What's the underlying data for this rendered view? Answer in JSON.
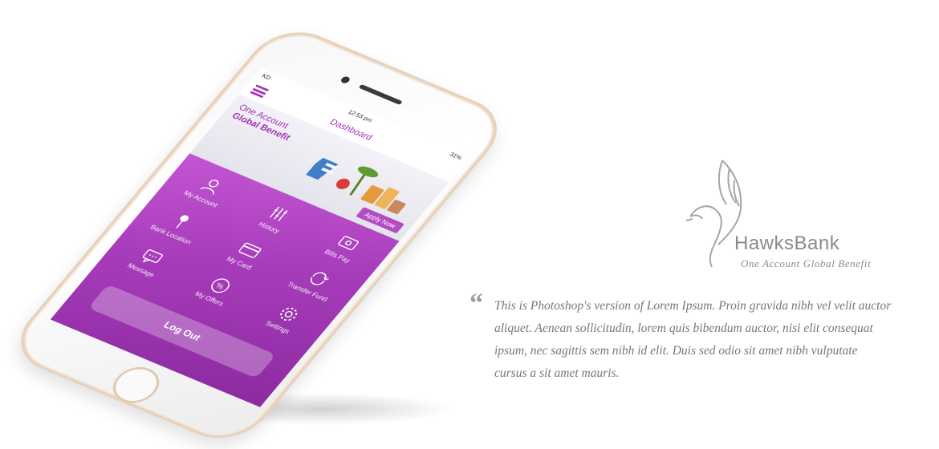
{
  "phone": {
    "status": {
      "carrier": "KD",
      "time": "12:53 pm",
      "battery": "31%"
    },
    "header": {
      "title": "Dashboard"
    },
    "banner": {
      "line1": "One Account",
      "line2": "Global Benefit",
      "cta": "Apply Now"
    },
    "tiles": [
      {
        "label": "My Account",
        "icon": "user-icon"
      },
      {
        "label": "History",
        "icon": "history-icon"
      },
      {
        "label": "Bills Pay",
        "icon": "bills-icon"
      },
      {
        "label": "Bank Location",
        "icon": "location-pin-icon"
      },
      {
        "label": "My Card",
        "icon": "card-icon"
      },
      {
        "label": "Transfer Fund",
        "icon": "transfer-icon"
      },
      {
        "label": "Message",
        "icon": "message-icon"
      },
      {
        "label": "My Offers",
        "icon": "offer-icon"
      },
      {
        "label": "Settings",
        "icon": "gear-icon"
      }
    ],
    "logout_label": "Log Out"
  },
  "brand": {
    "name": "HawksBank",
    "tagline": "One Account Global Benefit"
  },
  "quote": {
    "text": "This is Photoshop's version  of Lorem Ipsum. Proin gravida nibh vel velit auctor aliquet. Aenean sollicitudin, lorem quis bibendum auctor, nisi elit consequat ipsum, nec sagittis sem nibh id elit. Duis sed odio sit amet nibh vulputate cursus a sit amet mauris."
  },
  "colors": {
    "accent": "#a530b8",
    "dashboard_top": "#c255d2",
    "dashboard_bottom": "#8c2aa0",
    "brand_gray": "#8a8a8a"
  }
}
